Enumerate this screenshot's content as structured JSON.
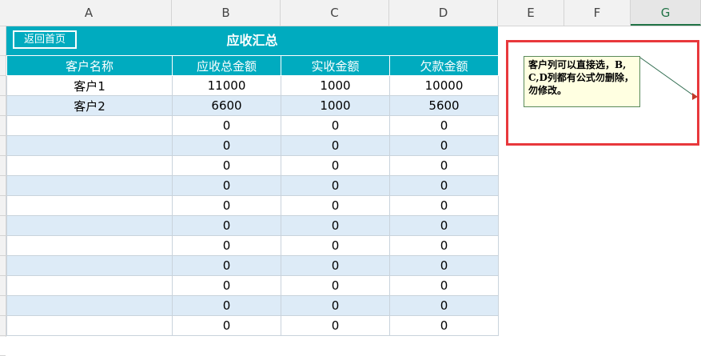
{
  "columns": [
    "A",
    "B",
    "C",
    "D",
    "E",
    "F",
    "G"
  ],
  "selected_column": "G",
  "back_button": "返回首页",
  "title": "应收汇总",
  "headers": [
    "客户名称",
    "应收总金额",
    "实收金额",
    "欠款金额"
  ],
  "rows": [
    [
      "客户1",
      "11000",
      "1000",
      "10000"
    ],
    [
      "客户2",
      "6600",
      "1000",
      "5600"
    ],
    [
      "",
      "0",
      "0",
      "0"
    ],
    [
      "",
      "0",
      "0",
      "0"
    ],
    [
      "",
      "0",
      "0",
      "0"
    ],
    [
      "",
      "0",
      "0",
      "0"
    ],
    [
      "",
      "0",
      "0",
      "0"
    ],
    [
      "",
      "0",
      "0",
      "0"
    ],
    [
      "",
      "0",
      "0",
      "0"
    ],
    [
      "",
      "0",
      "0",
      "0"
    ],
    [
      "",
      "0",
      "0",
      "0"
    ],
    [
      "",
      "0",
      "0",
      "0"
    ],
    [
      "",
      "0",
      "0",
      "0"
    ]
  ],
  "comment": "客户列可以直接选，B,C,D列都有公式勿删除，勿修改。",
  "colors": {
    "accent": "#00abbf",
    "row_alt": "#ddebf7",
    "highlight_box": "#e8383c",
    "comment_bg": "#ffffe1"
  }
}
